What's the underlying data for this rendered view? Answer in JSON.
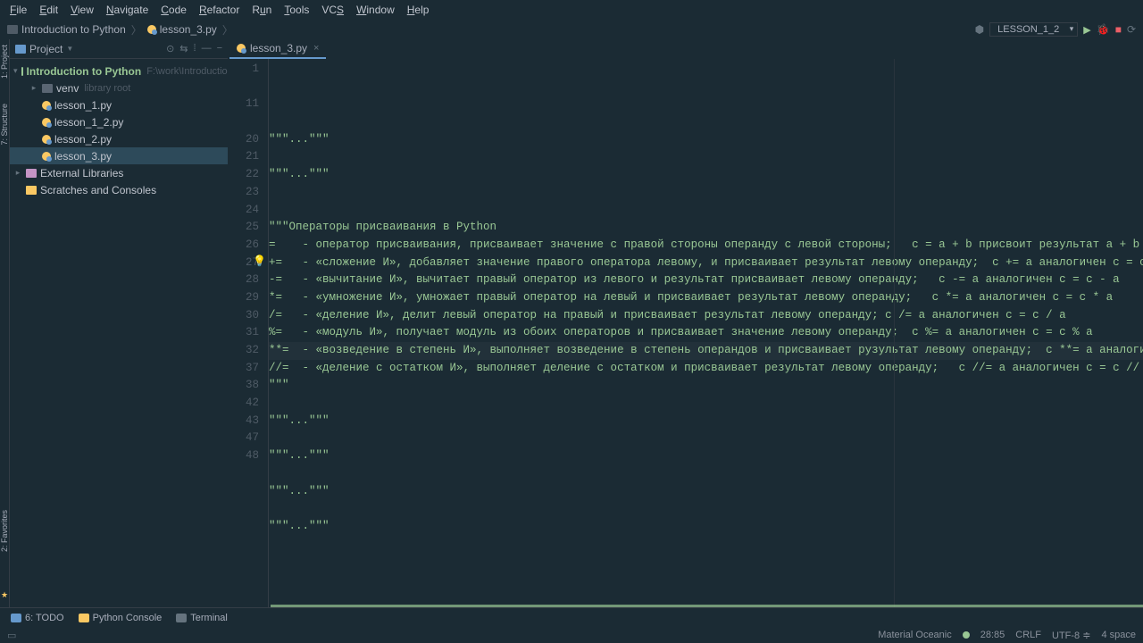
{
  "menubar": [
    "File",
    "Edit",
    "View",
    "Navigate",
    "Code",
    "Refactor",
    "Run",
    "Tools",
    "VCS",
    "Window",
    "Help"
  ],
  "breadcrumb": {
    "project": "Introduction to Python",
    "file": "lesson_3.py"
  },
  "run_config": "LESSON_1_2",
  "side_tabs": {
    "project": "1: Project",
    "structure": "7: Structure",
    "favorites": "2: Favorites"
  },
  "project_panel": {
    "title": "Project",
    "root": {
      "name": "Introduction to Python",
      "path": "F:\\work\\Introduction to Python"
    },
    "venv": {
      "name": "venv",
      "hint": "library root"
    },
    "files": [
      "lesson_1.py",
      "lesson_1_2.py",
      "lesson_2.py",
      "lesson_3.py"
    ],
    "ext_lib": "External Libraries",
    "scratches": "Scratches and Consoles"
  },
  "editor_tab": "lesson_3.py",
  "code": {
    "gutter": [
      "1",
      "",
      "11",
      "",
      "20",
      "21",
      "22",
      "23",
      "24",
      "25",
      "26",
      "27",
      "28",
      "29",
      "30",
      "31",
      "32",
      "37",
      "38",
      "42",
      "43",
      "47",
      "48"
    ],
    "bulb_row": 11,
    "caret_row": 12,
    "lines": [
      "\"\"\"...\"\"\"",
      "",
      "\"\"\"...\"\"\"",
      "",
      "",
      "\"\"\"Операторы присваивания в Python",
      "=    - оператор присваивания, присваивает значение с правой стороны операнду с левой стороны;   c = a + b присвоит результат a + b перемен",
      "+=   - «сложение И», добавляет значение правого оператора левому, и присваивает результат левому операнду;  c += a аналогичен c = c + a",
      "-=   - «вычитание И», вычитает правый оператор из левого и результат присваивает левому операнду;   c -= a аналогичен c = c - a",
      "*=   - «умножение И», умножает правый оператор на левый и присваивает результат левому операнду;   c *= a аналогичен c = c * a",
      "/=   - «деление И», делит левый оператор на правый и присваивает результат левому операнду; c /= a аналогичен c = c / a",
      "%=   - «модуль И», получает модуль из обоих операторов и присваивает значение левому операнду;  c %= a аналогичен c = c % a",
      "**=  - «возведение в степень И», выполняет возведение в степень операндов и присваивает рузультат левому операнду;  c **= a аналогичен = c",
      "//=  - «деление с остатком И», выполняет деление с остатком и присваивает результат левому операнду;   c //= a аналогичен c = c // a",
      "\"\"\"",
      "",
      "\"\"\"...\"\"\"",
      "",
      "\"\"\"...\"\"\"",
      "",
      "\"\"\"...\"\"\"",
      "",
      "\"\"\"...\"\"\""
    ]
  },
  "bottom_tools": {
    "todo": "6: TODO",
    "console": "Python Console",
    "terminal": "Terminal"
  },
  "status": {
    "theme": "Material Oceanic",
    "pos": "28:85",
    "eol": "CRLF",
    "enc": "UTF-8",
    "indent": "4 space"
  }
}
